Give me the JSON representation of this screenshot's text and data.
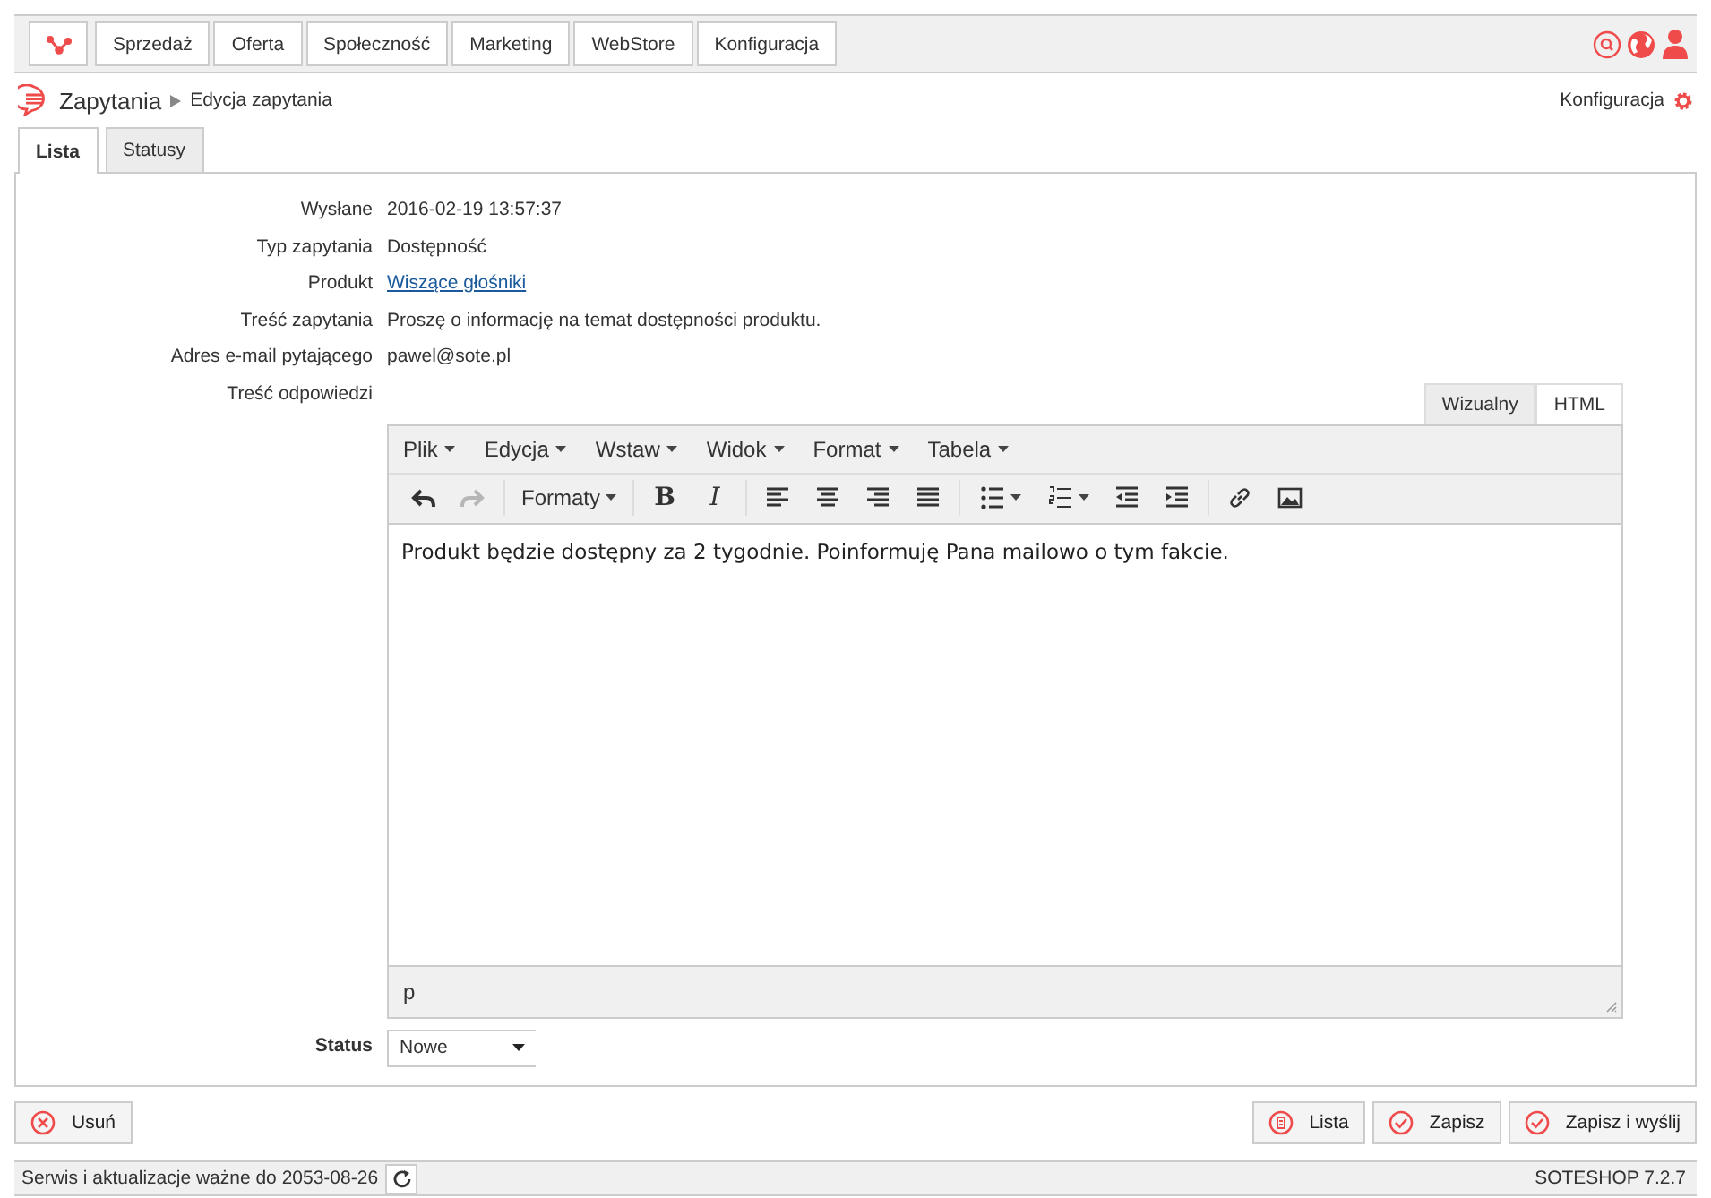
{
  "top_nav": {
    "items": [
      {
        "label": "Sprzedaż"
      },
      {
        "label": "Oferta"
      },
      {
        "label": "Społeczność"
      },
      {
        "label": "Marketing"
      },
      {
        "label": "WebStore"
      },
      {
        "label": "Konfiguracja"
      }
    ]
  },
  "breadcrumb": {
    "section": "Zapytania",
    "current": "Edycja zapytania"
  },
  "config_link": "Konfiguracja",
  "tabs": [
    {
      "label": "Lista",
      "selected": true
    },
    {
      "label": "Statusy",
      "selected": false
    }
  ],
  "fields": [
    {
      "label": "Wysłane",
      "value": "2016-02-19 13:57:37",
      "kind": "text"
    },
    {
      "label": "Typ zapytania",
      "value": "Dostępność",
      "kind": "text"
    },
    {
      "label": "Produkt",
      "value": "Wiszące głośniki",
      "kind": "link"
    },
    {
      "label": "Treść zapytania",
      "value": "Proszę o informację na temat dostępności produktu.",
      "kind": "text"
    },
    {
      "label": "Adres e-mail pytającego",
      "value": "pawel@sote.pl",
      "kind": "text"
    }
  ],
  "answer": {
    "label": "Treść odpowiedzi",
    "mode_tabs": [
      {
        "label": "Wizualny",
        "selected": false
      },
      {
        "label": "HTML",
        "selected": true
      }
    ],
    "menu": [
      "Plik",
      "Edycja",
      "Wstaw",
      "Widok",
      "Format",
      "Tabela"
    ],
    "history": [
      {
        "disabled": false
      },
      {
        "disabled": true
      }
    ],
    "formats_label": "Formaty",
    "bold_glyph": "B",
    "italic_glyph": "I",
    "content": "Produkt będzie dostępny za 2 tygodnie. Poinformuję Pana mailowo o tym fakcie.",
    "path": "p"
  },
  "status": {
    "label": "Status",
    "value": "Nowe"
  },
  "actions_left": [
    {
      "label": "Usuń",
      "kind": "delete"
    }
  ],
  "actions_right": [
    {
      "label": "Lista",
      "kind": "list"
    },
    {
      "label": "Zapisz",
      "kind": "confirm"
    },
    {
      "label": "Zapisz i wyślij",
      "kind": "confirm"
    }
  ],
  "status_bar": {
    "service": "Serwis i aktualizacje ważne do 2053-08-26",
    "version": "SOTESHOP 7.2.7"
  }
}
